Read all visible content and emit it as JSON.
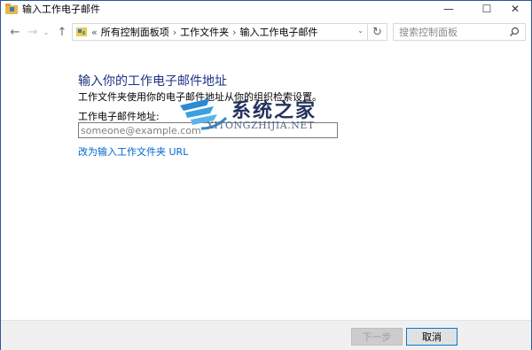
{
  "window": {
    "title": "输入工作电子邮件",
    "minimize_glyph": "—",
    "maximize_glyph": "☐",
    "close_glyph": "✕"
  },
  "nav": {
    "back_glyph": "←",
    "forward_glyph": "→",
    "recent_glyph": "⌄",
    "up_glyph": "↑",
    "overflow": "«",
    "breadcrumbs": [
      "所有控制面板项",
      "工作文件夹",
      "输入工作电子邮件"
    ],
    "refresh_glyph": "↻",
    "dropdown_glyph": "⌄",
    "search_placeholder": "搜索控制面板"
  },
  "content": {
    "heading": "输入你的工作电子邮件地址",
    "description": "工作文件夹使用你的电子邮件地址从你的组织检索设置。",
    "field_label": "工作电子邮件地址:",
    "email_value": "",
    "email_placeholder": "someone@example.com",
    "url_link": "改为输入工作文件夹 URL"
  },
  "watermark": {
    "text": "系统之家",
    "subtext": "XITONGZHIJIA.NET"
  },
  "footer": {
    "next_label": "下一步",
    "cancel_label": "取消"
  },
  "colors": {
    "heading": "#1e3287",
    "link": "#0066cc",
    "footer_bg": "#f0f0f0",
    "accent": "#0078d7"
  }
}
